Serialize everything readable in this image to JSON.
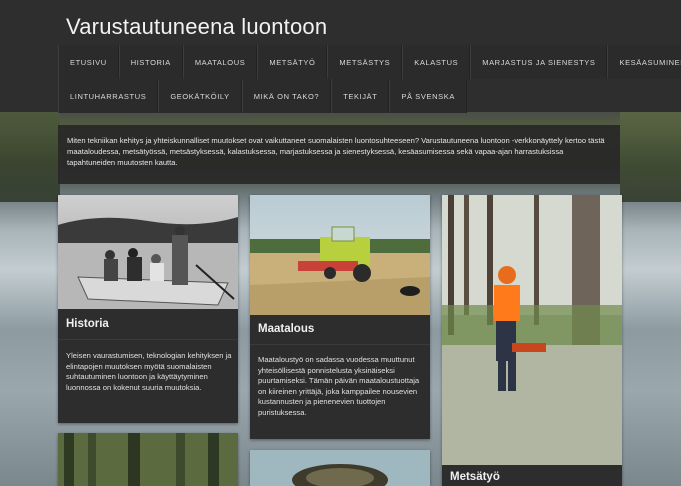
{
  "site": {
    "title": "Varustautuneena luontoon"
  },
  "nav": {
    "row1": [
      "ETUSIVU",
      "HISTORIA",
      "MAATALOUS",
      "METSÄTYÖ",
      "METSÄSTYS",
      "KALASTUS",
      "MARJASTUS JA SIENESTYS",
      "KESÄASUMINEN"
    ],
    "row2": [
      "LINTUHARRASTUS",
      "GEOKÄTKÖILY",
      "MIKÄ ON TAKO?",
      "TEKIJÄT",
      "PÅ SVENSKA"
    ]
  },
  "intro": {
    "text": "Miten tekniikan kehitys ja yhteiskunnalliset muutokset ovat vaikuttaneet suomalaisten luontosuhteeseen? Varustautuneena luontoon -verkkonäyttely kertoo tästä maataloudessa, metsätyössä, metsästyksessä, kalastuksessa, marjastuksessa ja sienestyksessä, kesäasumisessa sekä vapaa-ajan harrastuksissa tapahtuneiden muutosten kautta."
  },
  "cards": {
    "historia": {
      "title": "Historia",
      "text": "Yleisen vaurastumisen, teknologian kehityksen ja elintapojen muutoksen myötä suomalaisten suhtautuminen luontoon ja käyttäytyminen luonnossa on kokenut suuria muutoksia."
    },
    "maatalous": {
      "title": "Maatalous",
      "text": "Maataloustyö on sadassa vuodessa muuttunut yhteisöllisestä ponnistelusta yksinäiseksi puurtamiseksi. Tämän päivän maataloustuottaja on kiireinen yrittäjä, joka kamppailee nousevien kustannusten ja pienenevien tuottojen puristuksessa."
    },
    "metsatyo": {
      "title": "Metsätyö"
    }
  }
}
